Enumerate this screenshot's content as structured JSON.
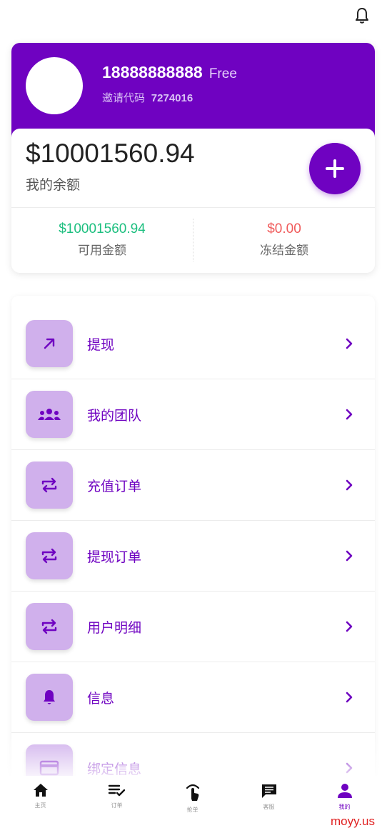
{
  "user": {
    "phone": "18888888888",
    "level": "Free",
    "invite_label": "邀请代码",
    "invite_code": "7274016"
  },
  "balance": {
    "amount": "$10001560.94",
    "label": "我的余额",
    "available_value": "$10001560.94",
    "available_label": "可用金额",
    "frozen_value": "$0.00",
    "frozen_label": "冻结金额"
  },
  "menu": [
    {
      "label": "提现",
      "icon": "arrow-up-right-icon"
    },
    {
      "label": "我的团队",
      "icon": "group-icon"
    },
    {
      "label": "充值订单",
      "icon": "repeat-icon"
    },
    {
      "label": "提现订单",
      "icon": "repeat-icon"
    },
    {
      "label": "用户明细",
      "icon": "repeat-icon"
    },
    {
      "label": "信息",
      "icon": "bell-icon"
    },
    {
      "label": "绑定信息",
      "icon": "card-icon"
    }
  ],
  "tabs": [
    {
      "label": "主页",
      "icon": "home-icon"
    },
    {
      "label": "订单",
      "icon": "list-check-icon"
    },
    {
      "label": "抢单",
      "icon": "touch-icon"
    },
    {
      "label": "客服",
      "icon": "chat-icon"
    },
    {
      "label": "我的",
      "icon": "person-icon"
    }
  ],
  "watermark": "moyy.us",
  "colors": {
    "primary": "#6f02c1",
    "icon_bg": "#d0b0ec",
    "available": "#1cbf7f",
    "frozen": "#f05a5a"
  }
}
